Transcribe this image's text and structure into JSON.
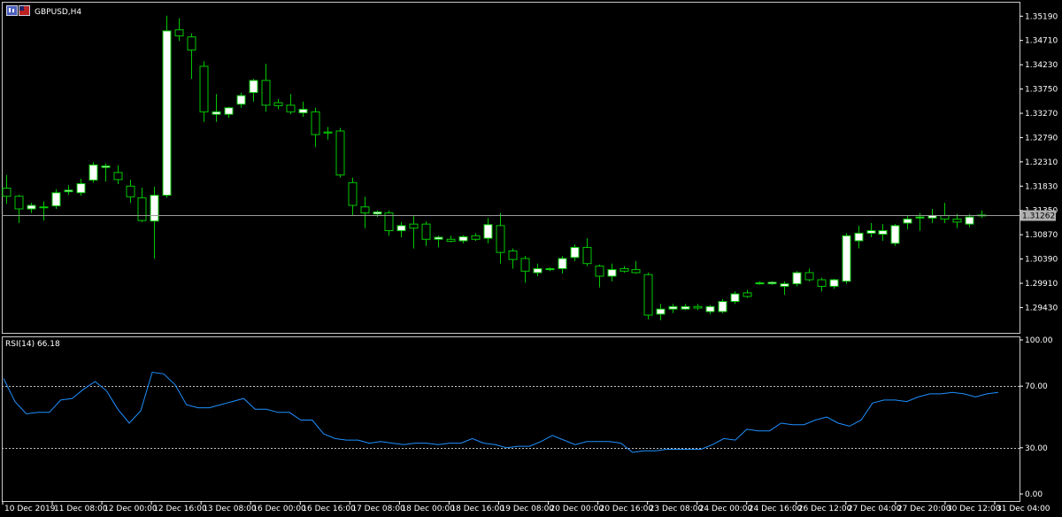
{
  "header": {
    "symbol_title": "GBPUSD,H4",
    "rsi_title": "RSI(14) 66.18"
  },
  "icons": [
    "chart-window-icon",
    "flag-icon"
  ],
  "colors": {
    "background": "#000000",
    "bull_fill": "#ffffff",
    "bear_fill": "#000000",
    "wick": "#00c800",
    "rsi_line": "#1e90ff",
    "grid_line": "#c0c0c0",
    "price_tag_bg": "#b0b0b0"
  },
  "chart_data": [
    {
      "type": "candlestick",
      "title": "GBPUSD,H4",
      "price_ticks": [
        "1.35190",
        "1.34710",
        "1.34230",
        "1.33750",
        "1.33270",
        "1.32790",
        "1.32310",
        "1.31830",
        "1.31350",
        "1.30870",
        "1.30390",
        "1.29910",
        "1.29430"
      ],
      "ylim": [
        1.29,
        1.353
      ],
      "current_price": "1.31262",
      "current_price_value": 1.31262,
      "candles": [
        {
          "o": 1.3179,
          "h": 1.3205,
          "l": 1.3148,
          "c": 1.3163
        },
        {
          "o": 1.3163,
          "h": 1.3166,
          "l": 1.311,
          "c": 1.3138
        },
        {
          "o": 1.3138,
          "h": 1.315,
          "l": 1.313,
          "c": 1.3145
        },
        {
          "o": 1.3142,
          "h": 1.3153,
          "l": 1.3115,
          "c": 1.3142
        },
        {
          "o": 1.3144,
          "h": 1.3177,
          "l": 1.3138,
          "c": 1.317
        },
        {
          "o": 1.3172,
          "h": 1.3185,
          "l": 1.3166,
          "c": 1.3175
        },
        {
          "o": 1.317,
          "h": 1.3198,
          "l": 1.3164,
          "c": 1.3188
        },
        {
          "o": 1.3195,
          "h": 1.323,
          "l": 1.319,
          "c": 1.3225
        },
        {
          "o": 1.322,
          "h": 1.3228,
          "l": 1.3192,
          "c": 1.3223
        },
        {
          "o": 1.321,
          "h": 1.3224,
          "l": 1.3187,
          "c": 1.3196
        },
        {
          "o": 1.3183,
          "h": 1.3196,
          "l": 1.315,
          "c": 1.3162
        },
        {
          "o": 1.316,
          "h": 1.318,
          "l": 1.3112,
          "c": 1.3115
        },
        {
          "o": 1.3114,
          "h": 1.3182,
          "l": 1.304,
          "c": 1.3165
        },
        {
          "o": 1.3165,
          "h": 1.352,
          "l": 1.316,
          "c": 1.349
        },
        {
          "o": 1.3492,
          "h": 1.3515,
          "l": 1.347,
          "c": 1.348
        },
        {
          "o": 1.3478,
          "h": 1.3485,
          "l": 1.3395,
          "c": 1.3452
        },
        {
          "o": 1.342,
          "h": 1.343,
          "l": 1.331,
          "c": 1.333
        },
        {
          "o": 1.3325,
          "h": 1.3365,
          "l": 1.331,
          "c": 1.333
        },
        {
          "o": 1.3325,
          "h": 1.334,
          "l": 1.3318,
          "c": 1.3338
        },
        {
          "o": 1.3345,
          "h": 1.3368,
          "l": 1.3338,
          "c": 1.3362
        },
        {
          "o": 1.3368,
          "h": 1.3395,
          "l": 1.335,
          "c": 1.3392
        },
        {
          "o": 1.3392,
          "h": 1.3425,
          "l": 1.333,
          "c": 1.3343
        },
        {
          "o": 1.3348,
          "h": 1.3355,
          "l": 1.3335,
          "c": 1.3342
        },
        {
          "o": 1.3343,
          "h": 1.3365,
          "l": 1.3325,
          "c": 1.333
        },
        {
          "o": 1.3328,
          "h": 1.335,
          "l": 1.332,
          "c": 1.3335
        },
        {
          "o": 1.333,
          "h": 1.3338,
          "l": 1.326,
          "c": 1.3285
        },
        {
          "o": 1.329,
          "h": 1.33,
          "l": 1.3275,
          "c": 1.3288
        },
        {
          "o": 1.3292,
          "h": 1.3298,
          "l": 1.32,
          "c": 1.3205
        },
        {
          "o": 1.319,
          "h": 1.32,
          "l": 1.3125,
          "c": 1.3145
        },
        {
          "o": 1.3142,
          "h": 1.3162,
          "l": 1.31,
          "c": 1.313
        },
        {
          "o": 1.3128,
          "h": 1.3135,
          "l": 1.3122,
          "c": 1.3132
        },
        {
          "o": 1.313,
          "h": 1.3135,
          "l": 1.3085,
          "c": 1.3095
        },
        {
          "o": 1.3095,
          "h": 1.3112,
          "l": 1.3082,
          "c": 1.3105
        },
        {
          "o": 1.3108,
          "h": 1.3125,
          "l": 1.306,
          "c": 1.31
        },
        {
          "o": 1.3108,
          "h": 1.3113,
          "l": 1.3065,
          "c": 1.3078
        },
        {
          "o": 1.3078,
          "h": 1.3085,
          "l": 1.3062,
          "c": 1.3082
        },
        {
          "o": 1.3078,
          "h": 1.3085,
          "l": 1.3072,
          "c": 1.3074
        },
        {
          "o": 1.3075,
          "h": 1.3086,
          "l": 1.307,
          "c": 1.3083
        },
        {
          "o": 1.3085,
          "h": 1.309,
          "l": 1.3075,
          "c": 1.3078
        },
        {
          "o": 1.308,
          "h": 1.312,
          "l": 1.307,
          "c": 1.3107
        },
        {
          "o": 1.3105,
          "h": 1.313,
          "l": 1.303,
          "c": 1.3052
        },
        {
          "o": 1.3055,
          "h": 1.306,
          "l": 1.302,
          "c": 1.3038
        },
        {
          "o": 1.304,
          "h": 1.3045,
          "l": 1.2992,
          "c": 1.3015
        },
        {
          "o": 1.3012,
          "h": 1.303,
          "l": 1.3005,
          "c": 1.302
        },
        {
          "o": 1.3018,
          "h": 1.3022,
          "l": 1.3015,
          "c": 1.302
        },
        {
          "o": 1.302,
          "h": 1.3045,
          "l": 1.301,
          "c": 1.304
        },
        {
          "o": 1.3042,
          "h": 1.3068,
          "l": 1.3035,
          "c": 1.3062
        },
        {
          "o": 1.3062,
          "h": 1.308,
          "l": 1.3025,
          "c": 1.303
        },
        {
          "o": 1.3025,
          "h": 1.3028,
          "l": 1.2983,
          "c": 1.3005
        },
        {
          "o": 1.3005,
          "h": 1.303,
          "l": 1.2995,
          "c": 1.3018
        },
        {
          "o": 1.302,
          "h": 1.3025,
          "l": 1.3012,
          "c": 1.3015
        },
        {
          "o": 1.3018,
          "h": 1.3035,
          "l": 1.301,
          "c": 1.3012
        },
        {
          "o": 1.3008,
          "h": 1.3012,
          "l": 1.292,
          "c": 1.2928
        },
        {
          "o": 1.293,
          "h": 1.295,
          "l": 1.2918,
          "c": 1.294
        },
        {
          "o": 1.294,
          "h": 1.295,
          "l": 1.2932,
          "c": 1.2945
        },
        {
          "o": 1.294,
          "h": 1.295,
          "l": 1.2938,
          "c": 1.2945
        },
        {
          "o": 1.2945,
          "h": 1.295,
          "l": 1.2938,
          "c": 1.2942
        },
        {
          "o": 1.2935,
          "h": 1.2948,
          "l": 1.293,
          "c": 1.2945
        },
        {
          "o": 1.2935,
          "h": 1.296,
          "l": 1.2932,
          "c": 1.2955
        },
        {
          "o": 1.2955,
          "h": 1.2975,
          "l": 1.295,
          "c": 1.297
        },
        {
          "o": 1.2972,
          "h": 1.2978,
          "l": 1.2962,
          "c": 1.2965
        },
        {
          "o": 1.299,
          "h": 1.2995,
          "l": 1.2988,
          "c": 1.2992
        },
        {
          "o": 1.299,
          "h": 1.2995,
          "l": 1.2988,
          "c": 1.2993
        },
        {
          "o": 1.2985,
          "h": 1.2995,
          "l": 1.2968,
          "c": 1.299
        },
        {
          "o": 1.299,
          "h": 1.3015,
          "l": 1.2985,
          "c": 1.3012
        },
        {
          "o": 1.3012,
          "h": 1.302,
          "l": 1.2995,
          "c": 1.2998
        },
        {
          "o": 1.2998,
          "h": 1.3002,
          "l": 1.2975,
          "c": 1.2985
        },
        {
          "o": 1.2985,
          "h": 1.3,
          "l": 1.298,
          "c": 1.2998
        },
        {
          "o": 1.2995,
          "h": 1.309,
          "l": 1.299,
          "c": 1.3085
        },
        {
          "o": 1.3075,
          "h": 1.3105,
          "l": 1.306,
          "c": 1.309
        },
        {
          "o": 1.309,
          "h": 1.311,
          "l": 1.3082,
          "c": 1.3095
        },
        {
          "o": 1.3088,
          "h": 1.3108,
          "l": 1.3075,
          "c": 1.3095
        },
        {
          "o": 1.307,
          "h": 1.3108,
          "l": 1.3065,
          "c": 1.3105
        },
        {
          "o": 1.311,
          "h": 1.3125,
          "l": 1.3098,
          "c": 1.3118
        },
        {
          "o": 1.312,
          "h": 1.313,
          "l": 1.3095,
          "c": 1.3122
        },
        {
          "o": 1.312,
          "h": 1.3138,
          "l": 1.311,
          "c": 1.3125
        },
        {
          "o": 1.3125,
          "h": 1.315,
          "l": 1.311,
          "c": 1.3118
        },
        {
          "o": 1.3118,
          "h": 1.3128,
          "l": 1.31,
          "c": 1.3112
        },
        {
          "o": 1.3108,
          "h": 1.3128,
          "l": 1.3102,
          "c": 1.3122
        },
        {
          "o": 1.3125,
          "h": 1.3135,
          "l": 1.312,
          "c": 1.3126
        }
      ],
      "x_tick_labels": [
        "10 Dec 2019",
        "11 Dec 08:00",
        "12 Dec 00:00",
        "12 Dec 16:00",
        "13 Dec 08:00",
        "16 Dec 00:00",
        "16 Dec 16:00",
        "17 Dec 08:00",
        "18 Dec 00:00",
        "18 Dec 16:00",
        "19 Dec 08:00",
        "20 Dec 00:00",
        "20 Dec 16:00",
        "23 Dec 08:00",
        "24 Dec 00:00",
        "24 Dec 16:00",
        "26 Dec 12:00",
        "27 Dec 04:00",
        "27 Dec 20:00",
        "30 Dec 12:00",
        "31 Dec 04:00"
      ]
    },
    {
      "type": "line",
      "title": "RSI(14) 66.18",
      "ylim": [
        0,
        100
      ],
      "y_ticks": [
        "100.00",
        "70.00",
        "30.00",
        "0.00"
      ],
      "levels": [
        70,
        30
      ],
      "series": [
        {
          "values": [
            75,
            60,
            52,
            53,
            53,
            61,
            62,
            68,
            73,
            67,
            55,
            46,
            54,
            79,
            78,
            71,
            58,
            56,
            56,
            58,
            60,
            62,
            55,
            55,
            53,
            53,
            48,
            48,
            39,
            36,
            35,
            35,
            33,
            34,
            33,
            32,
            33,
            33,
            32,
            33,
            33,
            36,
            33,
            32,
            30,
            31,
            31,
            34,
            38,
            35,
            32,
            34,
            34,
            34,
            33,
            27,
            28,
            28,
            29,
            29,
            29,
            29,
            32,
            36,
            35,
            42,
            41,
            41,
            46,
            45,
            45,
            48,
            50,
            46,
            44,
            48,
            59,
            61,
            61,
            60,
            63,
            65,
            65,
            66,
            65,
            63,
            65,
            66
          ]
        }
      ]
    }
  ]
}
